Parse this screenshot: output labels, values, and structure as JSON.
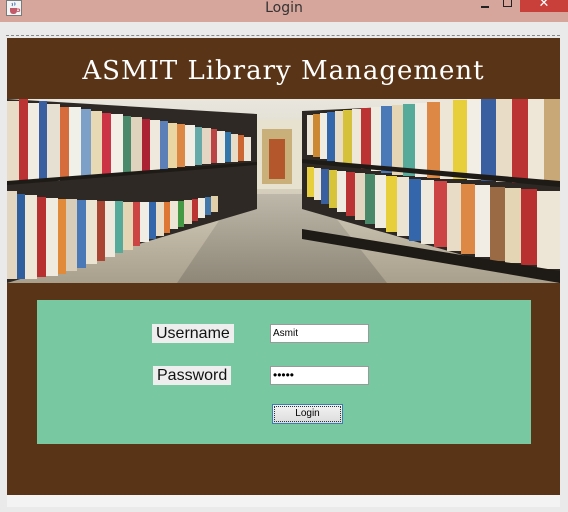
{
  "window": {
    "title": "Login",
    "close_glyph": "✕",
    "icon": "java-cup-icon",
    "minimize_icon": "minimize-icon",
    "maximize_icon": "maximize-icon"
  },
  "banner": {
    "heading": "ASMIT Library Management",
    "background_color": "#5a3416",
    "image": "library-bookshelves-image"
  },
  "login": {
    "username_label": "Username",
    "username_value": "Asmit",
    "password_label": "Password",
    "password_value": "•••••",
    "button_label": "Login",
    "panel_color": "#78c8a2"
  }
}
